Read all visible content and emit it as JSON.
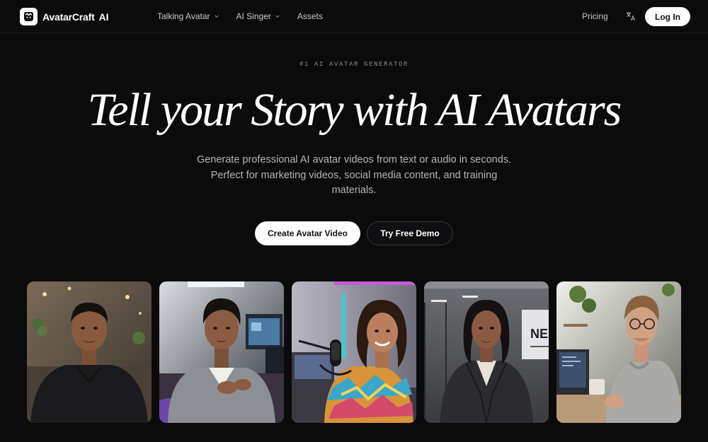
{
  "header": {
    "brand": {
      "name": "AvatarCraft",
      "suffix": "AI",
      "logo_icon": "avatar-logo-icon"
    },
    "nav": [
      {
        "label": "Talking Avatar",
        "has_dropdown": true
      },
      {
        "label": "AI Singer",
        "has_dropdown": true
      },
      {
        "label": "Assets",
        "has_dropdown": false
      }
    ],
    "pricing": "Pricing",
    "language_icon": "translate-icon",
    "login": "Log In"
  },
  "hero": {
    "eyebrow": "#1 AI AVATAR GENERATOR",
    "headline": "Tell your Story with AI Avatars",
    "subtitle": "Generate professional AI avatar videos from text or audio in seconds. Perfect for marketing videos, social media content, and training materials.",
    "primary_cta": "Create Avatar Video",
    "secondary_cta": "Try Free Demo"
  },
  "avatars": [
    {
      "icon": "avatar-image",
      "scene": "office",
      "colors": {
        "bg": "#5b4d40",
        "shirt": "#1b1b1d",
        "skin": "#8a5a3e",
        "hair": "#141010"
      }
    },
    {
      "icon": "avatar-image",
      "scene": "studio",
      "colors": {
        "bg": "#3a3e48",
        "shirt": "#8d8f95",
        "skin": "#8b5c41",
        "hair": "#15110f"
      }
    },
    {
      "icon": "avatar-image",
      "scene": "podcast",
      "colors": {
        "bg": "#7d7b86",
        "shirt": "#d9933a",
        "skin": "#b97f5f",
        "hair": "#2a1a12"
      }
    },
    {
      "icon": "avatar-image",
      "scene": "corporate",
      "colors": {
        "bg": "#57585c",
        "shirt": "#2c2c30",
        "skin": "#8c5a42",
        "hair": "#151012"
      }
    },
    {
      "icon": "avatar-image",
      "scene": "workspace",
      "colors": {
        "bg": "#6f7168",
        "shirt": "#a9aaa8",
        "skin": "#d1a184",
        "hair": "#8a6240"
      }
    }
  ],
  "corporate_sign": "NE"
}
